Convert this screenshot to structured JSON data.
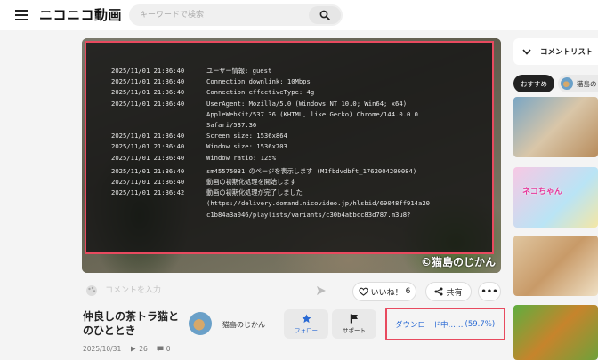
{
  "header": {
    "logo": "ニコニコ動画",
    "search_placeholder": "キーワードで検索"
  },
  "player": {
    "log": [
      {
        "ts": "2025/11/01 21:36:40",
        "msg": "ユーザー情報: guest"
      },
      {
        "ts": "2025/11/01 21:36:40",
        "msg": "Connection downlink: 10Mbps"
      },
      {
        "ts": "2025/11/01 21:36:40",
        "msg": "Connection effectiveType: 4g"
      },
      {
        "ts": "2025/11/01 21:36:40",
        "msg": "UserAgent: Mozilla/5.0 (Windows NT 10.0; Win64; x64)\nAppleWebKit/537.36 (KHTML, like Gecko) Chrome/144.0.0.0\nSafari/537.36"
      },
      {
        "ts": "2025/11/01 21:36:40",
        "msg": "Screen size: 1536x864"
      },
      {
        "ts": "2025/11/01 21:36:40",
        "msg": "Window size: 1536x703"
      },
      {
        "ts": "2025/11/01 21:36:40",
        "msg": "Window ratio: 125%"
      },
      {
        "ts": "2025/11/01 21:36:40",
        "msg": "sm45575031 のページを表示します (M1fbdvdbft_1762004200084)"
      },
      {
        "ts": "2025/11/01 21:36:40",
        "msg": "動画の初期化処理を開始します"
      },
      {
        "ts": "2025/11/01 21:36:42",
        "msg": "動画の初期化処理が完了しました\n(https://delivery.domand.nicovideo.jp/hlsbid/69048ff914a20\nc1b84a3a046/playlists/variants/c30b4abbcc83d787.m3u8?"
      }
    ],
    "watermark": "©猫島のじかん"
  },
  "comment": {
    "placeholder": "コメントを入力"
  },
  "actions": {
    "like_label": "いいね！",
    "like_count": "6",
    "share_label": "共有",
    "more_label": "•••"
  },
  "video": {
    "title": "仲良しの茶トラ猫とのひととき",
    "date": "2025/10/31",
    "views": "26",
    "comments": "0"
  },
  "owner": {
    "name": "猫島のじかん",
    "follow_label": "フォロー",
    "support_label": "サポート"
  },
  "download": {
    "label": "ダウンロード中……",
    "progress_text": "(59.7%)",
    "progress": 0.597
  },
  "sidebar": {
    "comment_list_title": "コメントリスト",
    "chip_recommended": "おすすめ",
    "chip_owner": "猫島のじ",
    "thumb2_text": "ネコちゃん"
  },
  "colors": {
    "highlight_border": "#e84a5f",
    "link_blue": "#2a6ad4"
  }
}
